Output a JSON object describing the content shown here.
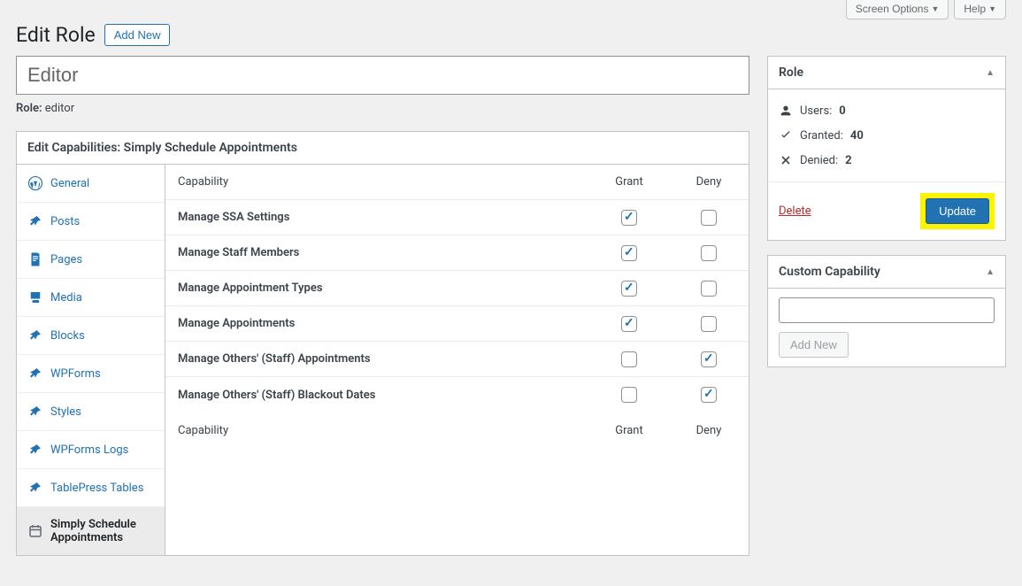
{
  "topbar": {
    "screen_options": "Screen Options",
    "help": "Help"
  },
  "header": {
    "title": "Edit Role",
    "add_new": "Add New"
  },
  "role_input": "Editor",
  "role_slug_label": "Role:",
  "role_slug": "editor",
  "caps_box_title": "Edit Capabilities: Simply Schedule Appointments",
  "tabs": [
    {
      "label": "General",
      "icon": "wp"
    },
    {
      "label": "Posts",
      "icon": "pin"
    },
    {
      "label": "Pages",
      "icon": "page"
    },
    {
      "label": "Media",
      "icon": "media"
    },
    {
      "label": "Blocks",
      "icon": "pin"
    },
    {
      "label": "WPForms",
      "icon": "pin"
    },
    {
      "label": "Styles",
      "icon": "pin"
    },
    {
      "label": "WPForms Logs",
      "icon": "pin"
    },
    {
      "label": "TablePress Tables",
      "icon": "pin"
    },
    {
      "label": "Simply Schedule Appointments",
      "icon": "cal",
      "active": true
    }
  ],
  "table": {
    "col_cap": "Capability",
    "col_grant": "Grant",
    "col_deny": "Deny",
    "rows": [
      {
        "name": "Manage SSA Settings",
        "grant": true,
        "deny": false
      },
      {
        "name": "Manage Staff Members",
        "grant": true,
        "deny": false
      },
      {
        "name": "Manage Appointment Types",
        "grant": true,
        "deny": false
      },
      {
        "name": "Manage Appointments",
        "grant": true,
        "deny": false
      },
      {
        "name": "Manage Others' (Staff) Appointments",
        "grant": false,
        "deny": true
      },
      {
        "name": "Manage Others' (Staff) Blackout Dates",
        "grant": false,
        "deny": true
      }
    ]
  },
  "role_box": {
    "title": "Role",
    "users_label": "Users:",
    "users": "0",
    "granted_label": "Granted:",
    "granted": "40",
    "denied_label": "Denied:",
    "denied": "2",
    "delete": "Delete",
    "update": "Update"
  },
  "custom_cap": {
    "title": "Custom Capability",
    "add_new": "Add New"
  }
}
